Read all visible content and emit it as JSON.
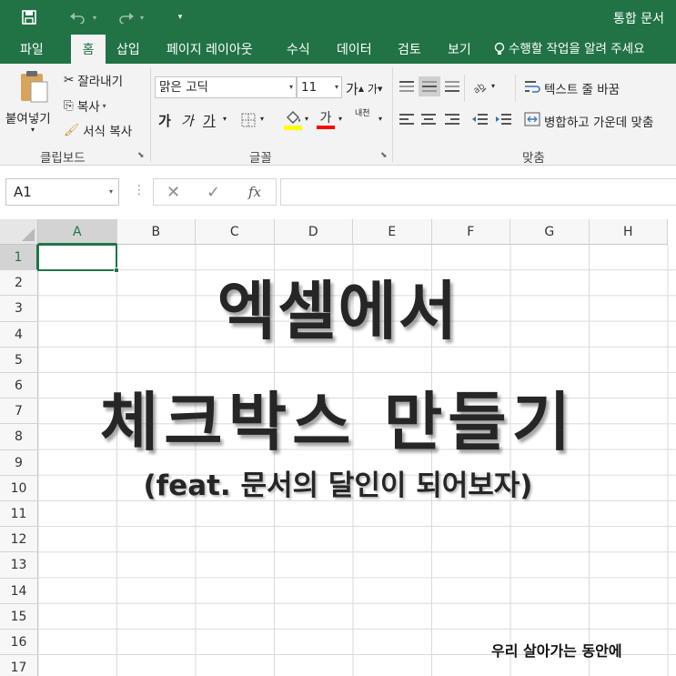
{
  "window": {
    "title": "통합 문서"
  },
  "quick_access": {
    "save": "save-icon",
    "undo": "undo-icon",
    "redo": "redo-icon",
    "customize": "qat-customize-icon"
  },
  "tabs": [
    "파일",
    "홈",
    "삽입",
    "페이지 레이아웃",
    "수식",
    "데이터",
    "검토",
    "보기"
  ],
  "active_tab": "홈",
  "tell_me": "수행할 작업을 알려 주세요",
  "ribbon": {
    "clipboard": {
      "paste": "붙여넣기",
      "cut": "잘라내기",
      "copy": "복사",
      "format_painter": "서식 복사",
      "label": "클립보드"
    },
    "font": {
      "font_name": "맑은 고딕",
      "font_size": "11",
      "grow": "가",
      "shrink": "가",
      "bold": "가",
      "italic": "가",
      "underline": "가",
      "font_color_glyph": "가",
      "phonetic": "내천",
      "label": "글꼴",
      "fill_color": "#ffff00",
      "font_color": "#ff0000"
    },
    "alignment": {
      "wrap_text": "텍스트 줄 바꿈",
      "merge_center": "병합하고 가운데 맞춤",
      "label": "맞춤"
    }
  },
  "formula_bar": {
    "name_box": "A1",
    "fx": "fx",
    "formula": ""
  },
  "sheet": {
    "columns": [
      "A",
      "B",
      "C",
      "D",
      "E",
      "F",
      "G",
      "H"
    ],
    "rows": [
      "1",
      "2",
      "3",
      "4",
      "5",
      "6",
      "7",
      "8",
      "9",
      "10",
      "11",
      "12",
      "13",
      "14",
      "15",
      "16",
      "17"
    ],
    "active_cell": "A1",
    "accent": "#217346"
  },
  "overlay": {
    "line1": "엑셀에서",
    "line2": "체크박스 만들기",
    "line3": "(feat. 문서의 달인이 되어보자)",
    "credit": "우리 살아가는 동안에"
  }
}
